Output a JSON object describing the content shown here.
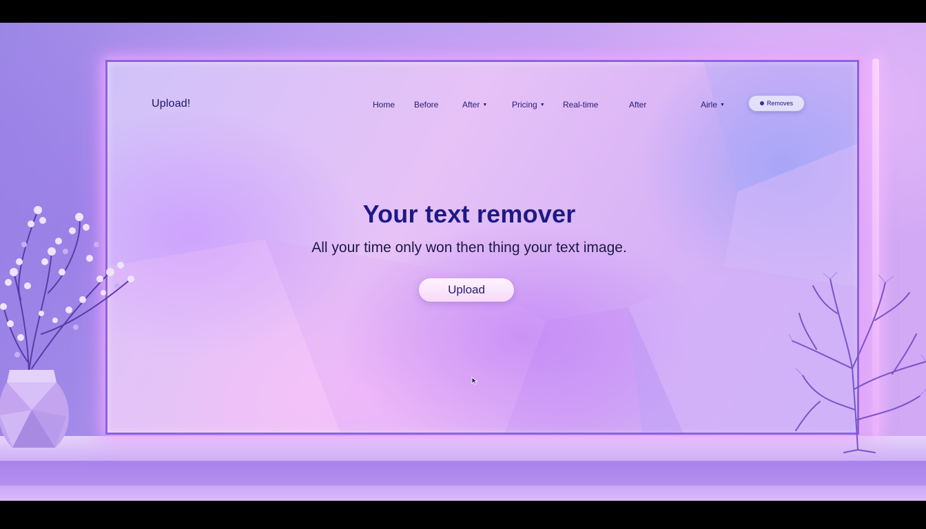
{
  "brand": {
    "label": "Upload!"
  },
  "nav": {
    "items": [
      {
        "label": "Home",
        "has_caret": false
      },
      {
        "label": "Before",
        "has_caret": false
      },
      {
        "label": "After",
        "has_caret": true
      },
      {
        "label": "Pricing",
        "has_caret": true
      },
      {
        "label": "Real-time",
        "has_caret": false
      },
      {
        "label": "After",
        "has_caret": false
      },
      {
        "label": "Airle",
        "has_caret": true
      }
    ],
    "caret_icon": "chevron-down-icon",
    "cta_label": "Removes"
  },
  "hero": {
    "title": "Your text remover",
    "subtitle": "All your time only won then thing your text image.",
    "upload_label": "Upload"
  },
  "colors": {
    "accent": "#1e1a84",
    "frame": "#8a63e0",
    "glow": "#f0aaff",
    "button_bg": "#f5daf8"
  },
  "icons": {
    "cursor": "pointer-cursor-icon",
    "plant": "flowering-plant-icon",
    "vase": "vase-icon",
    "tree": "bare-tree-icon"
  }
}
